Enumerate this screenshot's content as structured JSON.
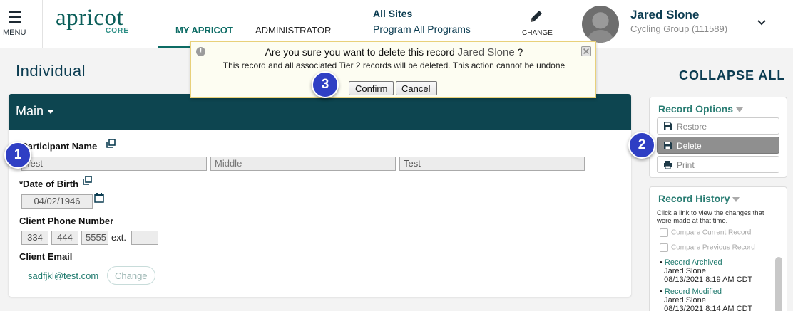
{
  "header": {
    "menu_label": "MENU",
    "logo_text": "apricot",
    "logo_sub": "CORE",
    "tabs": [
      {
        "label": "MY APRICOT",
        "active": true
      },
      {
        "label": "ADMINISTRATOR",
        "active": false
      }
    ],
    "site_title": "All Sites",
    "site_program": "Program All Programs",
    "change_label": "CHANGE",
    "user_name": "Jared Slone",
    "user_group": "Cycling Group (111589)"
  },
  "page": {
    "title": "Individual",
    "collapse_all": "COLLAPSE ALL"
  },
  "main_panel": {
    "header": "Main",
    "participant_label": "Participant Name",
    "name_fields": {
      "first": "Test",
      "middle_placeholder": "Middle",
      "last": "Test"
    },
    "dob_label": "*Date of Birth",
    "dob_value": "04/02/1946",
    "phone_label": "Client Phone Number",
    "phone": {
      "area": "334",
      "prefix": "444",
      "line": "5555",
      "ext_label": "ext.",
      "ext": ""
    },
    "email_label": "Client Email",
    "email_value": "sadfjkl@test.com",
    "email_change": "Change"
  },
  "record_options": {
    "title": "Record Options",
    "buttons": [
      {
        "label": "Restore",
        "icon": "save-icon",
        "active": false
      },
      {
        "label": "Delete",
        "icon": "save-icon",
        "active": true
      },
      {
        "label": "Print",
        "icon": "print-icon",
        "active": false
      }
    ]
  },
  "record_history": {
    "title": "Record History",
    "help": "Click a link to view the changes that were made at that time.",
    "checks": [
      "Compare Current Record",
      "Compare Previous Record"
    ],
    "entries": [
      {
        "action": "Record Archived",
        "user": "Jared Slone",
        "time": "08/13/2021 8:19 AM CDT"
      },
      {
        "action": "Record Modified",
        "user": "Jared Slone",
        "time": "08/13/2021 8:14 AM CDT"
      }
    ]
  },
  "dialog": {
    "title_prefix": "Are you sure you want to delete this record",
    "record_name": "Jared Slone",
    "title_suffix": "?",
    "body": "This record and all associated Tier 2 records will be deleted. This action cannot be undone",
    "confirm": "Confirm",
    "cancel": "Cancel"
  },
  "callouts": [
    "1",
    "2",
    "3"
  ],
  "colors": {
    "brand": "#0c5f5a",
    "panel_header": "#0d4550",
    "callout": "#2f3fc4",
    "dialog_bg": "#fdfdf2"
  }
}
